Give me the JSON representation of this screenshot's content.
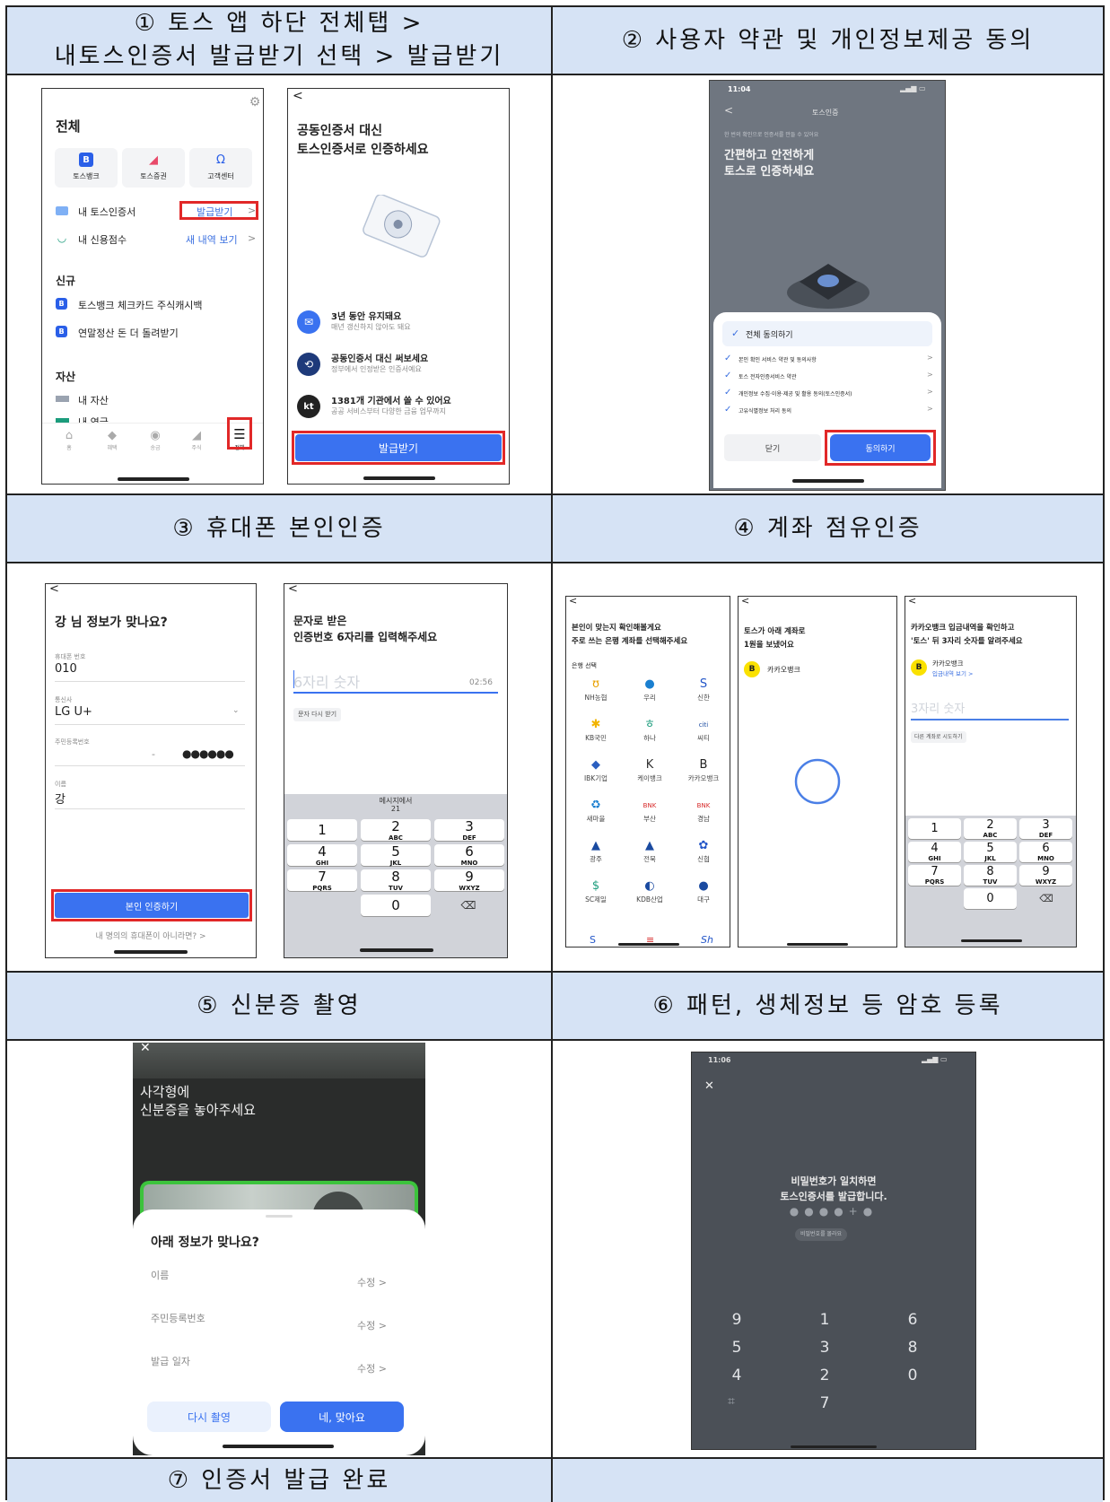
{
  "steps": [
    {
      "line1": "① 토스 앱 하단 전체탭 >",
      "line2": "내토스인증서 발급받기 선택 > 발급받기"
    },
    {
      "label": "② 사용자 약관 및 개인정보제공 동의"
    },
    {
      "label": "③ 휴대폰 본인인증"
    },
    {
      "label": "④ 계좌 점유인증"
    },
    {
      "label": "⑤ 신분증 촬영"
    },
    {
      "label": "⑥ 패턴, 생체정보 등 암호 등록"
    },
    {
      "label": "⑦ 인증서 발급 완료"
    }
  ],
  "s1a": {
    "title": "전체",
    "apps": [
      "토스뱅크",
      "토스증권",
      "고객센터"
    ],
    "row_cert_label": "내 토스인증서",
    "row_cert_action": "발급받기",
    "row_credit_label": "내 신용점수",
    "row_credit_action": "새 내역 보기",
    "section_new": "신규",
    "new_items": [
      "토스뱅크 체크카드 주식캐시백",
      "연말정산 돈 더 돌려받기"
    ],
    "section_assets": "자산",
    "asset_item": "내 자산",
    "asset_item2": "내 연금",
    "tabs": [
      "홈",
      "혜택",
      "송금",
      "주식",
      "전체"
    ]
  },
  "s1b": {
    "back": "<",
    "headline1": "공동인증서 대신",
    "headline2": "토스인증서로 인증하세요",
    "features": [
      {
        "title": "3년 동안 유지돼요",
        "sub": "매년 갱신하지 않아도 돼요"
      },
      {
        "title": "공동인증서 대신 써보세요",
        "sub": "정부에서 인정받은 인증서예요"
      },
      {
        "title": "1381개 기관에서 쓸 수 있어요",
        "sub": "공공 서비스부터 다양한 금융 업무까지"
      }
    ],
    "button": "발급받기"
  },
  "s2": {
    "time": "11:04",
    "screen_title": "토스인증",
    "back": "<",
    "small": "한 번의 확인으로 인증서를 만들 수 있어요",
    "headline1": "간편하고 안전하게",
    "headline2": "토스로 인증하세요",
    "agree_all": "전체 동의하기",
    "items": [
      "본인 확인 서비스 약관 및 동의사항",
      "토스 전자인증서비스 약관",
      "개인정보 수집·이용·제공 및 활용 동의(토스인증서)",
      "고유식별정보 처리 동의"
    ],
    "close": "닫기",
    "agree": "동의하기"
  },
  "s3a": {
    "back": "<",
    "title": "강 님 정보가 맞나요?",
    "phone_label": "휴대폰 번호",
    "phone_value": "010",
    "carrier_label": "통신사",
    "carrier_value": "LG U+",
    "rrn_label": "주민등록번호",
    "rrn_mask": "●●●●●●",
    "rrn_dash": "-",
    "name_label": "이름",
    "name_value": "강",
    "button": "본인 인증하기",
    "link": "내 명의의 휴대폰이 아니라면? >"
  },
  "s3b": {
    "back": "<",
    "title1": "문자로 받은",
    "title2": "인증번호 6자리를 입력해주세요",
    "placeholder": "6자리 숫자",
    "timer": "02:56",
    "resend": "문자 다시 받기",
    "sms_hint1": "메시지에서",
    "sms_hint2": "21"
  },
  "keypad": [
    {
      "n": "1",
      "l": ""
    },
    {
      "n": "2",
      "l": "ABC"
    },
    {
      "n": "3",
      "l": "DEF"
    },
    {
      "n": "4",
      "l": "GHI"
    },
    {
      "n": "5",
      "l": "JKL"
    },
    {
      "n": "6",
      "l": "MNO"
    },
    {
      "n": "7",
      "l": "PQRS"
    },
    {
      "n": "8",
      "l": "TUV"
    },
    {
      "n": "9",
      "l": "WXYZ"
    },
    {
      "n": "0",
      "l": ""
    }
  ],
  "s4a": {
    "back": "<",
    "title1": "본인이 맞는지 확인해볼게요",
    "title2": "주로 쓰는 은행 계좌를 선택해주세요",
    "section": "은행 선택",
    "banks": [
      {
        "name": "NH농협",
        "icon": "ʊ",
        "color": "#e8a100"
      },
      {
        "name": "우리",
        "icon": "●",
        "color": "#1a7fd0"
      },
      {
        "name": "신한",
        "icon": "S",
        "color": "#2356c8"
      },
      {
        "name": "KB국민",
        "icon": "✱",
        "color": "#f2b400"
      },
      {
        "name": "하나",
        "icon": "ㅎ",
        "color": "#1b9c7c"
      },
      {
        "name": "씨티",
        "icon": "citi",
        "color": "#1a4aa0"
      },
      {
        "name": "IBK기업",
        "icon": "◆",
        "color": "#2a5fc0"
      },
      {
        "name": "케이뱅크",
        "icon": "K",
        "color": "#333"
      },
      {
        "name": "카카오뱅크",
        "icon": "B",
        "color": "#222"
      },
      {
        "name": "새마을",
        "icon": "♻",
        "color": "#1a7fd0"
      },
      {
        "name": "부산",
        "icon": "BNK",
        "color": "#d62828"
      },
      {
        "name": "경남",
        "icon": "BNK",
        "color": "#d62828"
      },
      {
        "name": "광주",
        "icon": "▲",
        "color": "#1a4aa0"
      },
      {
        "name": "전북",
        "icon": "▲",
        "color": "#1a4aa0"
      },
      {
        "name": "신협",
        "icon": "✿",
        "color": "#2356c8"
      },
      {
        "name": "SC제일",
        "icon": "$",
        "color": "#1b9c7c"
      },
      {
        "name": "KDB산업",
        "icon": "◐",
        "color": "#1a4aa0"
      },
      {
        "name": "대구",
        "icon": "●",
        "color": "#1a4aa0"
      }
    ],
    "partial": [
      "S",
      "≡",
      "Sh"
    ]
  },
  "s4b": {
    "back": "<",
    "title1": "토스가 아래 계좌로",
    "title2": "1원을 보냈어요",
    "bank": "카카오뱅크"
  },
  "s4c": {
    "back": "<",
    "title1": "카카오뱅크 입금내역을 확인하고",
    "title2": "'토스' 뒤 3자리 숫자를 알려주세요",
    "bank": "카카오뱅크",
    "link": "입금내역 보기 >",
    "placeholder": "3자리 숫자",
    "retry": "다른 계좌로 시도하기"
  },
  "s5": {
    "close": "✕",
    "title1": "사각형에",
    "title2": "신분증을 놓아주세요",
    "sheet_title": "아래 정보가 맞나요?",
    "fields": [
      "이름",
      "주민등록번호",
      "발급 일자"
    ],
    "edit": "수정 >",
    "retake": "다시 촬영",
    "confirm": "네, 맞아요"
  },
  "s6": {
    "time": "11:06",
    "close": "✕",
    "msg1": "비밀번호가 일치하면",
    "msg2": "토스인증서를 발급합니다.",
    "forgot": "비밀번호를 몰라요",
    "keys": [
      "9",
      "1",
      "6",
      "5",
      "3",
      "8",
      "4",
      "2",
      "0",
      "",
      "7",
      ""
    ]
  }
}
